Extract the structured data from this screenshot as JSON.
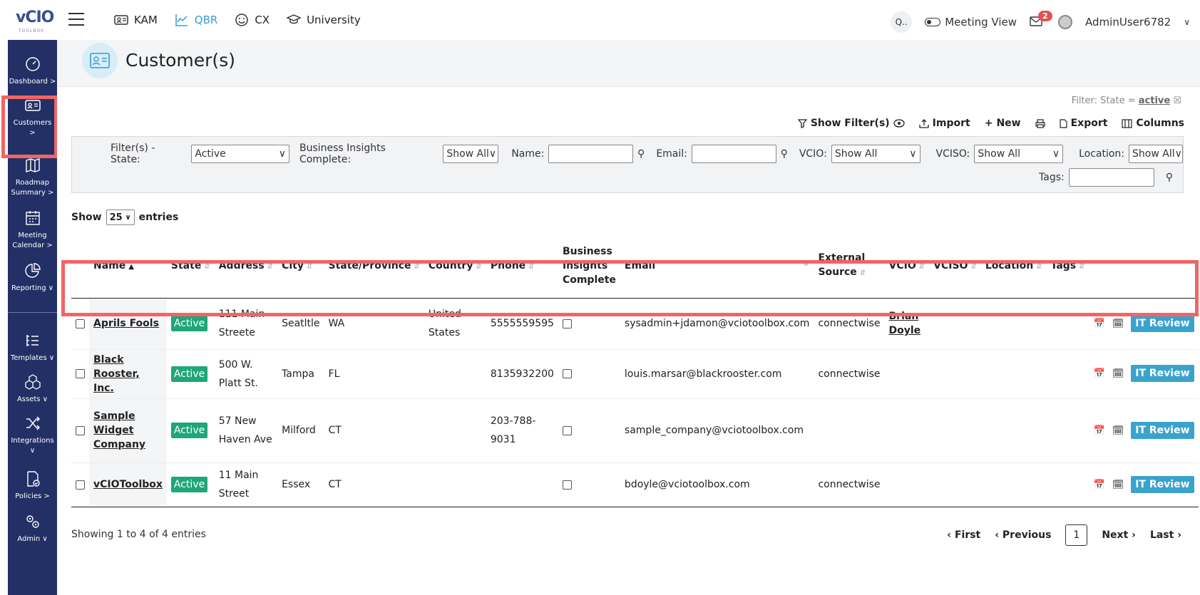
{
  "app": {
    "logo_text": "vCIO",
    "logo_sub": "TOOLBOX"
  },
  "topnav": [
    {
      "label": "KAM",
      "icon": "id-card-icon"
    },
    {
      "label": "QBR",
      "icon": "chart-line-icon",
      "active": true
    },
    {
      "label": "CX",
      "icon": "smile-icon"
    },
    {
      "label": "University",
      "icon": "graduation-cap-icon"
    }
  ],
  "topright": {
    "search_label": "Q..",
    "meeting_view": "Meeting View",
    "mail_badge": "2",
    "user": "AdminUser6782"
  },
  "sidebar": {
    "items": [
      {
        "label": "Dashboard >",
        "icon": "dashboard-icon"
      },
      {
        "label": "Customers",
        "sub": ">",
        "icon": "id-card-icon",
        "active": true
      },
      {
        "label": "Roadmap Summary >",
        "icon": "map-icon"
      },
      {
        "label": "Meeting Calendar >",
        "icon": "calendar-icon"
      },
      {
        "label": "Reporting ∨",
        "icon": "pie-chart-icon"
      },
      {
        "label": "Templates ∨",
        "icon": "list-icon"
      },
      {
        "label": "Assets ∨",
        "icon": "cubes-icon"
      },
      {
        "label": "Integrations ∨",
        "icon": "shuffle-icon"
      },
      {
        "label": "Policies >",
        "icon": "file-check-icon"
      },
      {
        "label": "Admin ∨",
        "icon": "gears-icon"
      }
    ]
  },
  "page": {
    "title": "Customer(s)",
    "filter_note_prefix": "Filter: State = ",
    "filter_note_value": "active",
    "filter_note_close": "☒"
  },
  "toolbar": {
    "show_filters": "Show Filter(s)",
    "import": "Import",
    "new": "New",
    "export": "Export",
    "columns": "Columns"
  },
  "filters": {
    "state_label": "Filter(s) - State:",
    "state_value": "Active",
    "bi_label": "Business Insights Complete:",
    "bi_value": "Show All",
    "name_label": "Name:",
    "email_label": "Email:",
    "vcio_label": "VCIO:",
    "vcio_value": "Show All",
    "vciso_label": "VCISO:",
    "vciso_value": "Show All",
    "location_label": "Location:",
    "location_value": "Show All",
    "tags_label": "Tags:"
  },
  "entries": {
    "show": "Show",
    "value": "25",
    "suffix": "entries"
  },
  "table": {
    "headers": {
      "name": "Name",
      "state": "State",
      "address": "Address",
      "city": "City",
      "province": "State/Province",
      "country": "Country",
      "phone": "Phone",
      "bi": "Business Insights Complete",
      "email": "Email",
      "external": "External Source",
      "vcio": "VCIO",
      "vciso": "VCISO",
      "location": "Location",
      "tags": "Tags"
    },
    "rows": [
      {
        "name": "Aprils Fools",
        "state": "Active",
        "address": "111 Main Streete",
        "city": "Seatltle",
        "province": "WA",
        "country": "United States",
        "phone": "5555559595",
        "email": "sysadmin+jdamon@vciotoolbox.com",
        "external": "connectwise",
        "vcio": "Brian Doyle",
        "action": "IT Review"
      },
      {
        "name": "Black Rooster, Inc.",
        "state": "Active",
        "address": "500 W. Platt St.",
        "city": "Tampa",
        "province": "FL",
        "country": "",
        "phone": "8135932200",
        "email": "louis.marsar@blackrooster.com",
        "external": "connectwise",
        "vcio": "",
        "action": "IT Review"
      },
      {
        "name": "Sample Widget Company",
        "state": "Active",
        "address": "57 New Haven Ave",
        "city": "Milford",
        "province": "CT",
        "country": "",
        "phone": "203-788-9031",
        "email": "sample_company@vciotoolbox.com",
        "external": "",
        "vcio": "",
        "action": "IT Review"
      },
      {
        "name": "vCIOToolbox",
        "state": "Active",
        "address": "11 Main Street",
        "city": "Essex",
        "province": "CT",
        "country": "",
        "phone": "",
        "email": "bdoyle@vciotoolbox.com",
        "external": "connectwise",
        "vcio": "",
        "action": "IT Review"
      }
    ]
  },
  "footer": {
    "info": "Showing 1 to 4 of 4 entries",
    "first": "First",
    "previous": "Previous",
    "page": "1",
    "next": "Next",
    "last": "Last"
  },
  "colors": {
    "sidebar": "#233066",
    "accent": "#3a9bd4",
    "status": "#1fa67a",
    "highlight": "#f26465",
    "button": "#3aa3cd"
  }
}
